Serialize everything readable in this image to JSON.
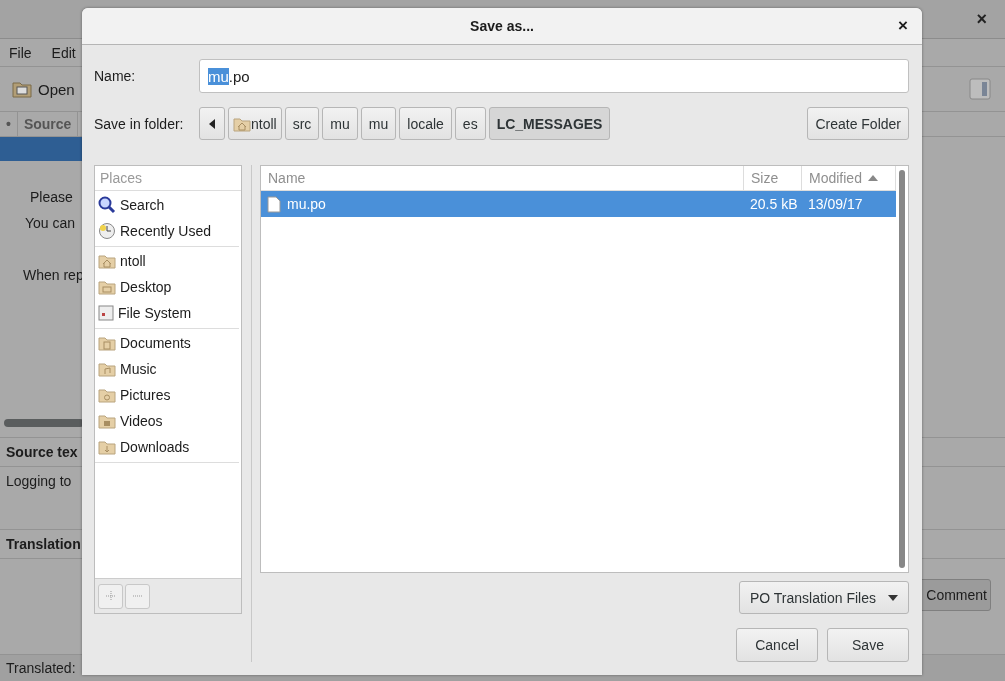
{
  "background_window": {
    "close": "×",
    "menu": [
      "File",
      "Edit"
    ],
    "toolbar_open": "Open",
    "columns": [
      "•",
      "Source"
    ],
    "message_lines": [
      "Please",
      "You can",
      "When rep"
    ],
    "source_heading": "Source tex",
    "source_value": "Logging to",
    "translation_heading": "Translation",
    "comment_button": "Comment",
    "status": "Translated:"
  },
  "dialog": {
    "title": "Save as...",
    "close": "×",
    "name_label": "Name:",
    "name_field": {
      "selected_text": "mu",
      "rest": ".po"
    },
    "folder_label": "Save in folder:",
    "path": [
      {
        "label": "ntoll",
        "kind": "home",
        "selected": false
      },
      {
        "label": "src",
        "kind": "folder",
        "selected": false
      },
      {
        "label": "mu",
        "kind": "folder",
        "selected": false
      },
      {
        "label": "mu",
        "kind": "folder",
        "selected": false
      },
      {
        "label": "locale",
        "kind": "folder",
        "selected": false
      },
      {
        "label": "es",
        "kind": "folder",
        "selected": false
      },
      {
        "label": "LC_MESSAGES",
        "kind": "folder",
        "selected": true
      }
    ],
    "create_folder": "Create Folder",
    "places": {
      "heading": "Places",
      "groups": [
        [
          {
            "label": "Search",
            "kind": "search"
          },
          {
            "label": "Recently Used",
            "kind": "recent"
          }
        ],
        [
          {
            "label": "ntoll",
            "kind": "home"
          },
          {
            "label": "Desktop",
            "kind": "desktop"
          },
          {
            "label": "File System",
            "kind": "drive"
          }
        ],
        [
          {
            "label": "Documents",
            "kind": "documents"
          },
          {
            "label": "Music",
            "kind": "music"
          },
          {
            "label": "Pictures",
            "kind": "pictures"
          },
          {
            "label": "Videos",
            "kind": "videos"
          },
          {
            "label": "Downloads",
            "kind": "downloads"
          }
        ]
      ]
    },
    "files": {
      "columns": [
        {
          "label": "Name"
        },
        {
          "label": "Size"
        },
        {
          "label": "Modified",
          "sorted": true
        }
      ],
      "rows": [
        {
          "name": "mu.po",
          "size": "20.5 kB",
          "modified": "13/09/17",
          "selected": true
        }
      ]
    },
    "filter": "PO Translation Files",
    "buttons": [
      "Cancel",
      "Save"
    ]
  }
}
